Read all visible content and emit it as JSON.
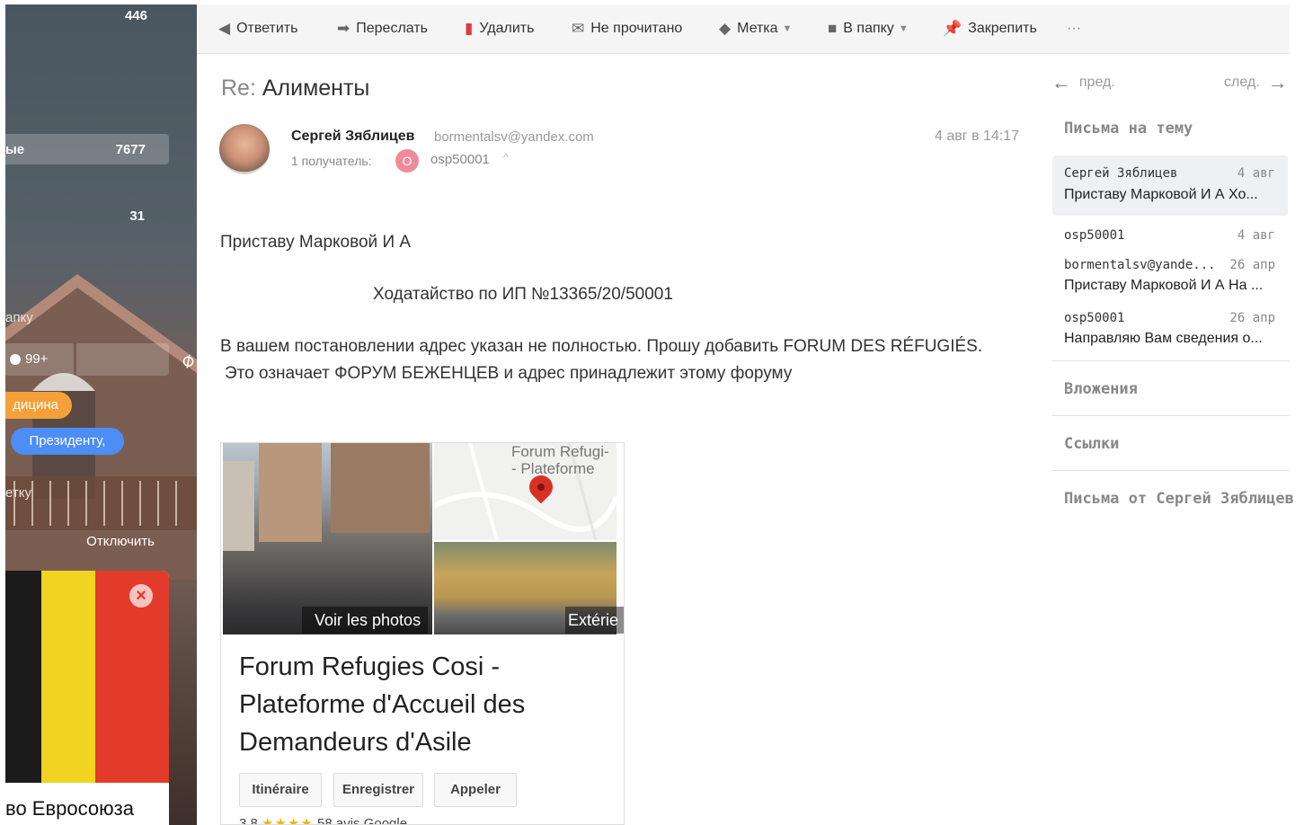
{
  "sidebar": {
    "count_top": "446",
    "folder_partial": "ые",
    "folder_count": "7677",
    "count_31": "31",
    "text_partial_1": "апку",
    "unread_badge": "99+",
    "tag_orange": "дицина",
    "tag_blue": "Президенту,",
    "text_partial_2": "етку",
    "disable_label": "Отключить",
    "ad_close": "×",
    "ad_caption": "во Евросоюза"
  },
  "toolbar": {
    "reply": "Ответить",
    "forward": "Переслать",
    "delete": "Удалить",
    "unread": "Не прочитано",
    "label": "Метка",
    "folder": "В папку",
    "pin": "Закрепить",
    "more": "···"
  },
  "message": {
    "subject_prefix": "Re:",
    "subject": "Алименты",
    "sender_name": "Сергей Зяблицев",
    "sender_email": "bormentalsv@yandex.com",
    "recipients_label": "1 получатель:",
    "recipient_initial": "O",
    "recipient_name": "osp50001",
    "date": "4 авг в 14:17",
    "line1": "Приставу Марковой И А",
    "line2": "Ходатайство по ИП №13365/20/50001",
    "line3": "В вашем постановлении адрес указан не полностью. Прошу добавить FORUM DES RÉFUGIÉS.",
    "line4": "Это означает ФОРУМ БЕЖЕНЦЕВ и адрес принадлежит этому форуму"
  },
  "map_card": {
    "photos_label": "Voir les photos",
    "map_label": "Forum Refugi- - Plateforme",
    "exterior_label": "Extérie",
    "title": "Forum Refugies Cosi - Plateforme d'Accueil des Demandeurs d'Asile",
    "btn_route": "Itinéraire",
    "btn_save": "Enregistrer",
    "btn_call": "Appeler",
    "rating_value": "3,8",
    "rating_stars": "★★★★",
    "rating_reviews": "58 avis Google"
  },
  "right_panel": {
    "prev": "пред.",
    "next": "след.",
    "thread_title": "Письма на тему",
    "threads": [
      {
        "from": "Сергей Зяблицев",
        "date": "4 авг",
        "subject": "Приставу Марковой И А Хо..."
      },
      {
        "from": "osp50001",
        "date": "4 авг",
        "subject": ""
      },
      {
        "from": "bormentalsv@yande...",
        "date": "26 апр",
        "subject": "Приставу Марковой И А На ..."
      },
      {
        "from": "osp50001",
        "date": "26 апр",
        "subject": "Направляю Вам сведения о..."
      }
    ],
    "attachments": "Вложения",
    "links": "Ссылки",
    "from_sender": "Письма от Сергей Зяблицев"
  },
  "colors": {
    "tag_orange": "#f4a13a",
    "tag_blue": "#4c8df6",
    "delete_icon": "#e0393e",
    "pin_red": "#d93025"
  }
}
